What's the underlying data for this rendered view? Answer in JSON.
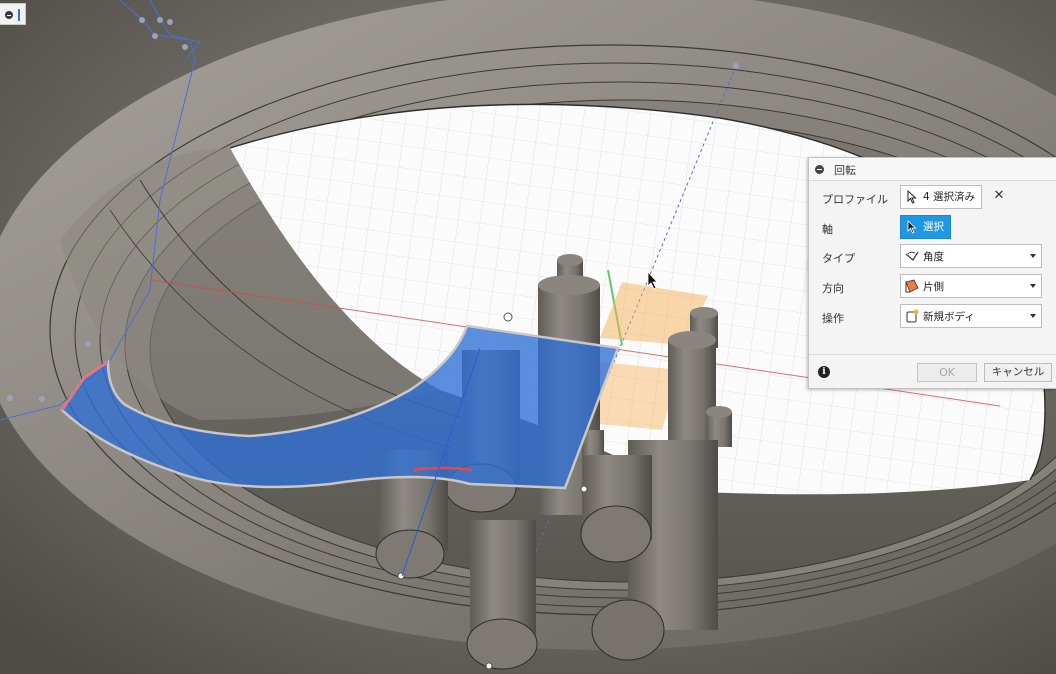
{
  "dialog": {
    "title": "回転",
    "rows": {
      "profile": {
        "label": "プロファイル",
        "value": "4 選択済み"
      },
      "axis": {
        "label": "軸",
        "value": "選択"
      },
      "type": {
        "label": "タイプ",
        "value": "角度",
        "icon": "angle-icon"
      },
      "direction": {
        "label": "方向",
        "value": "片側",
        "icon": "one-side-icon"
      },
      "operation": {
        "label": "操作",
        "value": "新規ボディ",
        "icon": "new-body-icon"
      }
    },
    "ok": "OK",
    "cancel": "キャンセル"
  },
  "colors": {
    "selection_blue": "#2f6fd6",
    "active_button": "#1f97e3",
    "preview_orange": "#f6b25a",
    "model_gray": "#7a766f"
  }
}
